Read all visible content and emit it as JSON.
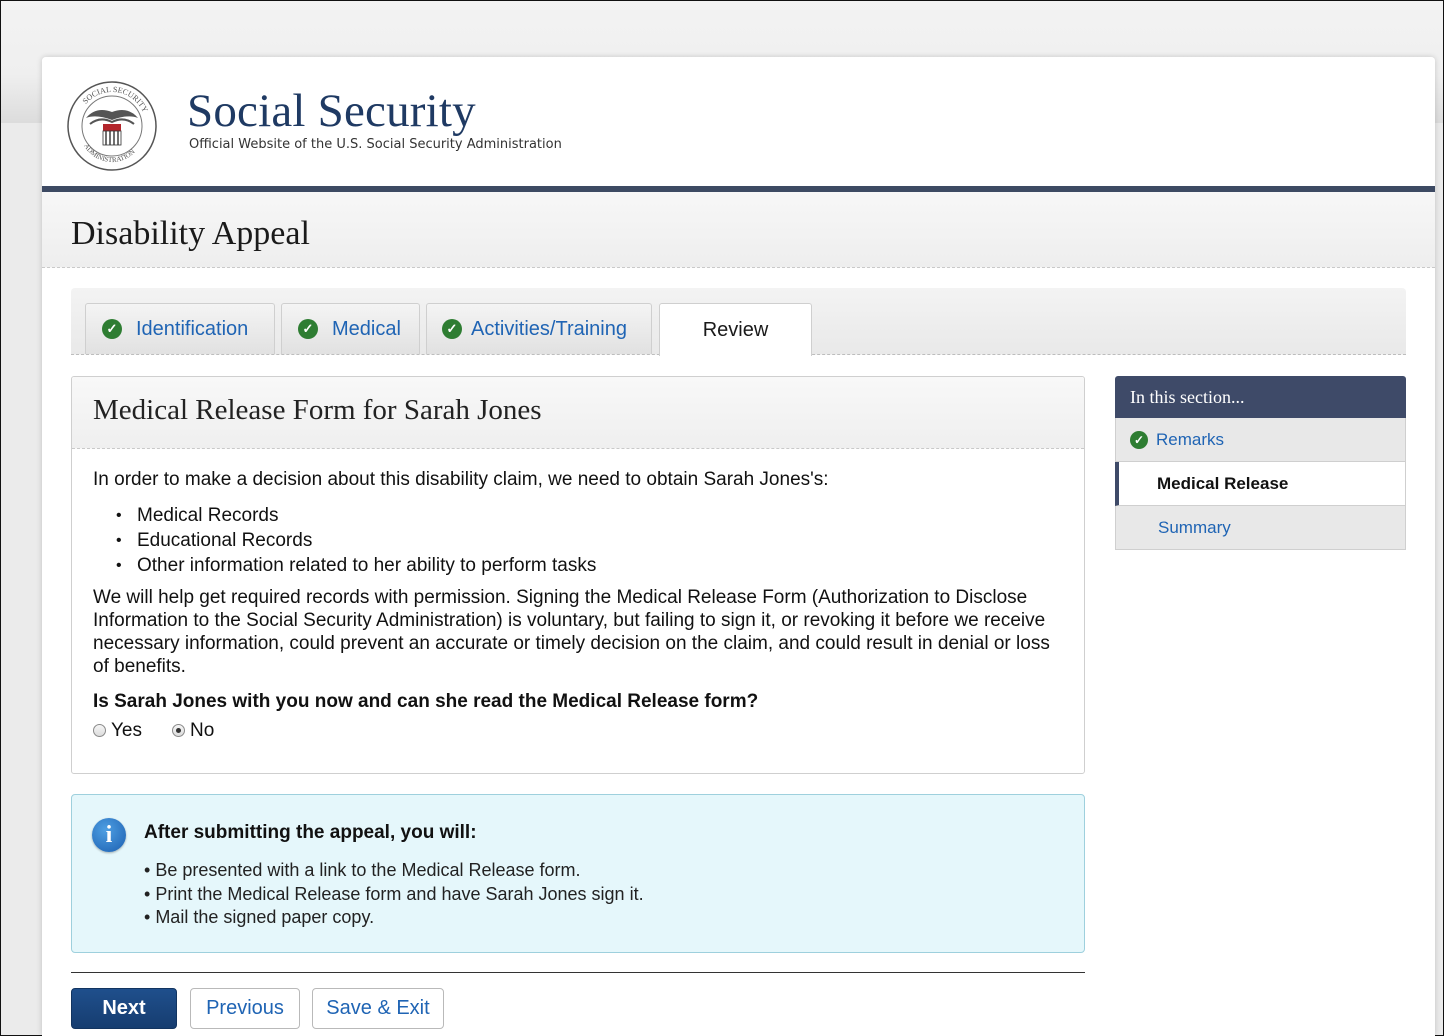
{
  "header": {
    "site_title": "Social Security",
    "site_subtitle": "Official Website of the U.S. Social Security Administration",
    "seal_text": "SOCIAL SECURITY ADMINISTRATION USA"
  },
  "page": {
    "title": "Disability Appeal"
  },
  "tabs": [
    {
      "label": "Identification",
      "complete": true
    },
    {
      "label": "Medical",
      "complete": true
    },
    {
      "label": "Activities/Training",
      "complete": true
    },
    {
      "label": "Review",
      "complete": false,
      "active": true
    }
  ],
  "main": {
    "title": "Medical Release Form for Sarah Jones",
    "intro": "In order to make a decision about this disability claim, we need to obtain Sarah Jones's:",
    "records": [
      "Medical Records",
      "Educational Records",
      "Other information related to her ability to perform tasks"
    ],
    "explanation": "We will help get required records with permission. Signing the Medical Release Form (Authorization to Disclose Information to the Social Security Administration) is voluntary, but failing to sign it, or revoking it before we receive necessary information, could prevent an accurate or timely decision on the claim, and could result in denial or loss of benefits.",
    "question": "Is Sarah Jones with you now and can she read the Medical Release form?",
    "options": [
      "Yes",
      "No"
    ],
    "selected": "No"
  },
  "info": {
    "title": "After submitting the appeal, you will:",
    "items": [
      "Be presented with a link to the Medical Release form.",
      "Print the Medical Release form and have Sarah Jones sign it.",
      "Mail the signed paper copy."
    ]
  },
  "buttons": {
    "next": "Next",
    "previous": "Previous",
    "save_exit": "Save & Exit"
  },
  "sidebar": {
    "heading": "In this section...",
    "items": [
      {
        "label": "Remarks",
        "complete": true
      },
      {
        "label": "Medical Release",
        "current": true
      },
      {
        "label": "Summary"
      }
    ]
  },
  "colors": {
    "brand_navy": "#1f3a63",
    "header_bar": "#3d4a63",
    "link_blue": "#1f64b4",
    "check_green": "#2e7d32",
    "info_bg": "#e5f7fb"
  }
}
